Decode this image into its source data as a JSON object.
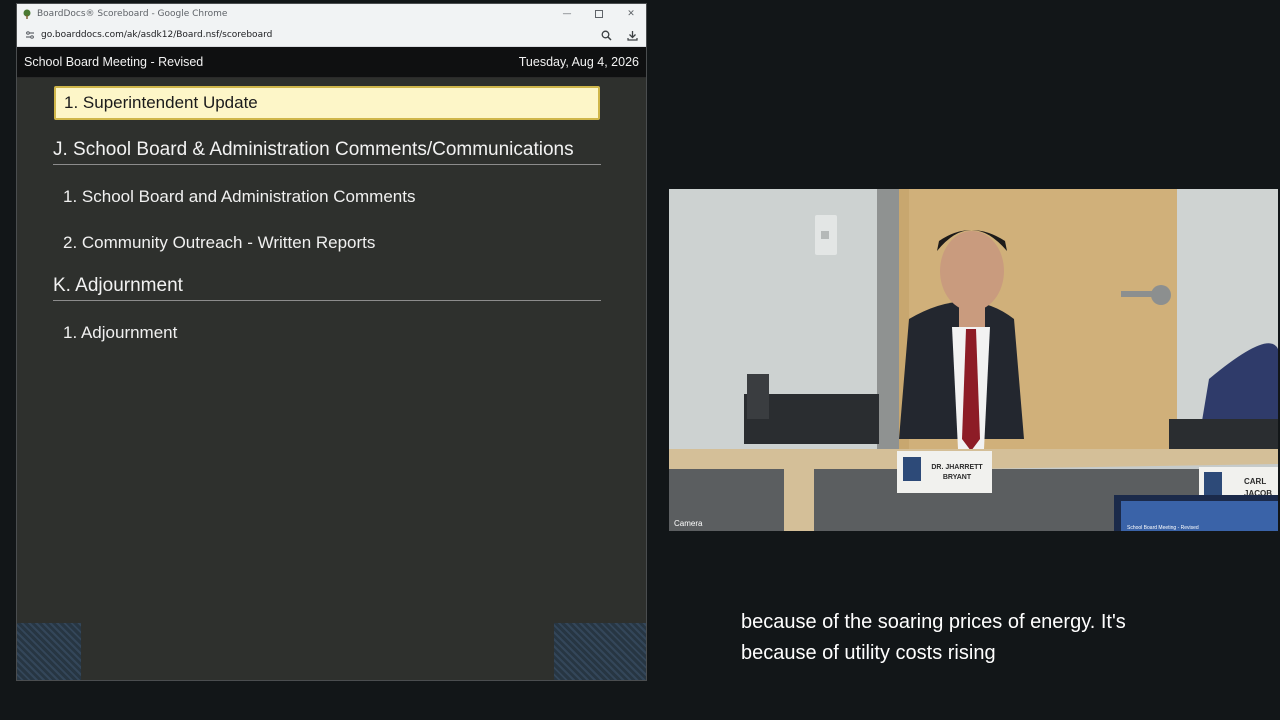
{
  "browser": {
    "window_title": "BoardDocs® Scoreboard - Google Chrome",
    "url": "go.boarddocs.com/ak/asdk12/Board.nsf/scoreboard"
  },
  "meeting": {
    "title": "School Board Meeting - Revised",
    "date": "Tuesday, Aug 4, 2026"
  },
  "agenda": {
    "current_item": "1. Superintendent Update",
    "sections": [
      {
        "title": "J. School Board & Administration Comments/Communications",
        "items": [
          "1. School Board and Administration Comments",
          "2. Community Outreach - Written Reports"
        ]
      },
      {
        "title": "K. Adjournment",
        "items": [
          "1. Adjournment"
        ]
      }
    ]
  },
  "video": {
    "label": "Camera",
    "nameplates": [
      "DR. JHARRETT BRYANT",
      "CARL JACOB"
    ],
    "monitor_text": "School Board Meeting - Revised"
  },
  "caption": {
    "line1": "because of the soaring prices of energy. It's",
    "line2": "because of utility costs rising"
  },
  "colors": {
    "active_item_bg": "#fdf6c8",
    "active_item_border": "#cfb64a",
    "panel_bg": "#2e302d",
    "page_bg": "#121618"
  }
}
